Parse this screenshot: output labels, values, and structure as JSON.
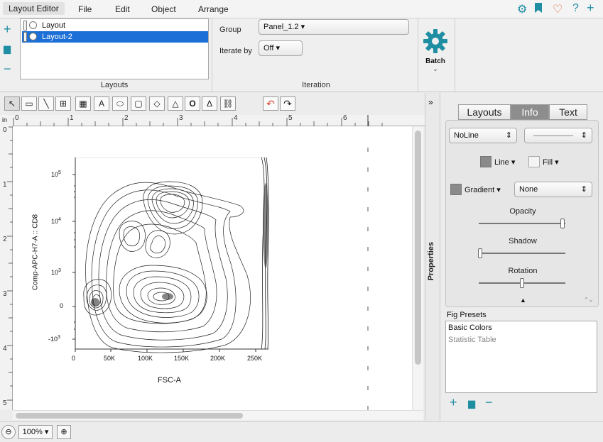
{
  "menu": {
    "items": [
      "Layout Editor",
      "File",
      "Edit",
      "Object",
      "Arrange"
    ],
    "right_icons": [
      "gear-icon",
      "bookmark-icon",
      "heart-icon",
      "help-icon",
      "plus-icon"
    ]
  },
  "ribbon": {
    "layouts": {
      "items": [
        {
          "label": "Layout",
          "selected": false
        },
        {
          "label": "Layout-2",
          "selected": true
        }
      ],
      "group_label": "Layouts"
    },
    "iteration": {
      "group_label": "Iteration",
      "group_field_label": "Group",
      "group_value": "Panel_1.2 ▾",
      "iterate_label": "Iterate by",
      "iterate_value": "Off ▾"
    },
    "batch": {
      "label": "Batch"
    }
  },
  "toolbar": {
    "tools": [
      "↖",
      "▭",
      "╲",
      "⊞",
      "▦",
      "A",
      "⬭",
      "▢",
      "◇",
      "△",
      "O",
      "Δ",
      "⛓",
      "↶",
      "↷"
    ]
  },
  "ruler": {
    "unit": "in",
    "top_labels": [
      "0",
      "1",
      "2",
      "3",
      "4",
      "5",
      "6"
    ],
    "left_labels": [
      "0",
      "1",
      "2",
      "3",
      "4",
      "5"
    ]
  },
  "plot": {
    "ylabel": "Comp-APC-H7-A :: CD8",
    "xlabel": "FSC-A",
    "xticks": [
      "0",
      "50K",
      "100K",
      "150K",
      "200K",
      "250K"
    ],
    "yticks": [
      "10",
      "10",
      "10",
      "0",
      "-10"
    ],
    "yexp": [
      "5",
      "4",
      "3",
      "",
      "3"
    ]
  },
  "status": {
    "zoom": "100% ▾"
  },
  "properties": {
    "strip_label": "Properties",
    "expand_glyph": "»",
    "tabs": [
      "Layouts",
      "Info",
      "Text"
    ],
    "active_tab": "Info",
    "line_style": "NoLine",
    "line_label": "Line ▾",
    "fill_label": "Fill ▾",
    "gradient_label": "Gradient ▾",
    "gradient_value": "None",
    "opacity_label": "Opacity",
    "shadow_label": "Shadow",
    "rotation_label": "Rotation",
    "opacity_value": 0.97,
    "shadow_value": 0.02,
    "rotation_value": 0.5,
    "presets_label": "Fig Presets",
    "presets": [
      "Basic Colors",
      "Statistic Table"
    ],
    "colors": {
      "swatch": "#8a8a8a",
      "accent": "#1f8ea3",
      "selection": "#1b6fd6"
    }
  }
}
